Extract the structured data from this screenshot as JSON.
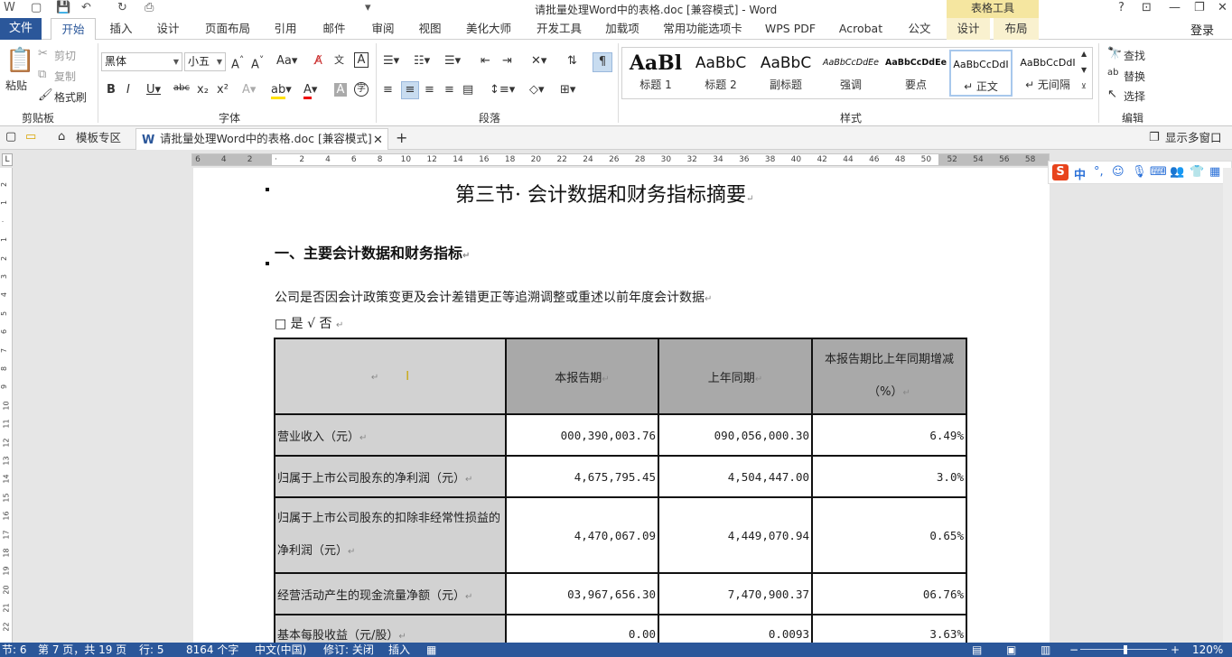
{
  "window": {
    "title": "请批量处理Word中的表格.doc [兼容模式] - Word",
    "table_tools": "表格工具",
    "help": "?",
    "login": "登录"
  },
  "menu": {
    "file": "文件",
    "tabs": [
      "开始",
      "插入",
      "设计",
      "页面布局",
      "引用",
      "邮件",
      "审阅",
      "视图",
      "美化大师",
      "开发工具",
      "加载项",
      "常用功能选项卡",
      "WPS PDF",
      "Acrobat",
      "公文"
    ],
    "table_tabs": [
      "设计",
      "布局"
    ],
    "active": "开始"
  },
  "ribbon": {
    "clipboard": {
      "label": "剪贴板",
      "paste": "粘贴",
      "cut": "剪切",
      "copy": "复制",
      "format_painter": "格式刷"
    },
    "font": {
      "label": "字体",
      "font_name": "黑体",
      "font_size": "小五"
    },
    "paragraph": {
      "label": "段落"
    },
    "styles": {
      "label": "样式",
      "items": [
        {
          "preview": "AaBl",
          "name": "标题 1"
        },
        {
          "preview": "AaBbC",
          "name": "标题 2"
        },
        {
          "preview": "AaBbC",
          "name": "副标题"
        },
        {
          "preview": "AaBbCcDdEe",
          "name": "强调"
        },
        {
          "preview": "AaBbCcDdEe",
          "name": "要点"
        },
        {
          "preview": "AaBbCcDdI",
          "name": "↵ 正文"
        },
        {
          "preview": "AaBbCcDdI",
          "name": "↵ 无间隔"
        }
      ]
    },
    "editing": {
      "label": "编辑",
      "find": "查找",
      "replace": "替换",
      "select": "选择"
    }
  },
  "doc_tabs": {
    "templates": "模板专区",
    "current": "请批量处理Word中的表格.doc [兼容模式]",
    "multi_window": "显示多窗口"
  },
  "ruler": {
    "h_ticks": [
      "6",
      "4",
      "2",
      "",
      "2",
      "4",
      "6",
      "8",
      "10",
      "12",
      "14",
      "16",
      "18",
      "20",
      "22",
      "24",
      "26",
      "28",
      "30",
      "32",
      "34",
      "36",
      "38",
      "40",
      "42",
      "44",
      "46",
      "48",
      "50",
      "52",
      "54",
      "56",
      "58"
    ],
    "v_ticks": [
      "2",
      "1",
      "",
      "1",
      "2",
      "3",
      "4",
      "5",
      "6",
      "7",
      "8",
      "9",
      "10",
      "11",
      "12",
      "13",
      "14",
      "15",
      "16",
      "17",
      "18",
      "19",
      "20",
      "21",
      "22"
    ]
  },
  "document": {
    "section_title": "第三节· 会计数据和财务指标摘要",
    "heading": "一、主要会计数据和财务指标",
    "paragraph1": "公司是否因会计政策变更及会计差错更正等追溯调整或重述以前年度会计数据",
    "paragraph2": "□ 是 √ 否",
    "para_mark": "↵",
    "table": {
      "headers": [
        "",
        "本报告期",
        "上年同期",
        "本报告期比上年同期增减（%）"
      ],
      "rows": [
        [
          "营业收入（元）",
          "000,390,003.76",
          "090,056,000.30",
          "6.49%"
        ],
        [
          "归属于上市公司股东的净利润（元）",
          "4,675,795.45",
          "4,504,447.00",
          "3.0%"
        ],
        [
          "归属于上市公司股东的扣除非经常性损益的净利润（元）",
          "4,470,067.09",
          "4,449,070.94",
          "0.65%"
        ],
        [
          "经营活动产生的现金流量净额（元）",
          "03,967,656.30",
          "7,470,900.37",
          "06.76%"
        ],
        [
          "基本每股收益（元/股）",
          "0.00",
          "0.0093",
          "3.63%"
        ]
      ]
    }
  },
  "status": {
    "section": "节: 6",
    "page": "第 7 页，共 19 页",
    "line": "行: 5",
    "words": "8164 个字",
    "language": "中文(中国)",
    "revision": "修订: 关闭",
    "mode": "插入",
    "zoom": "120%"
  },
  "colors": {
    "accent": "#2b579a",
    "table_label_bg": "#d2d2d2",
    "table_header_bg": "#a9a9a9",
    "table_tools_bg": "#f5e6a0"
  }
}
